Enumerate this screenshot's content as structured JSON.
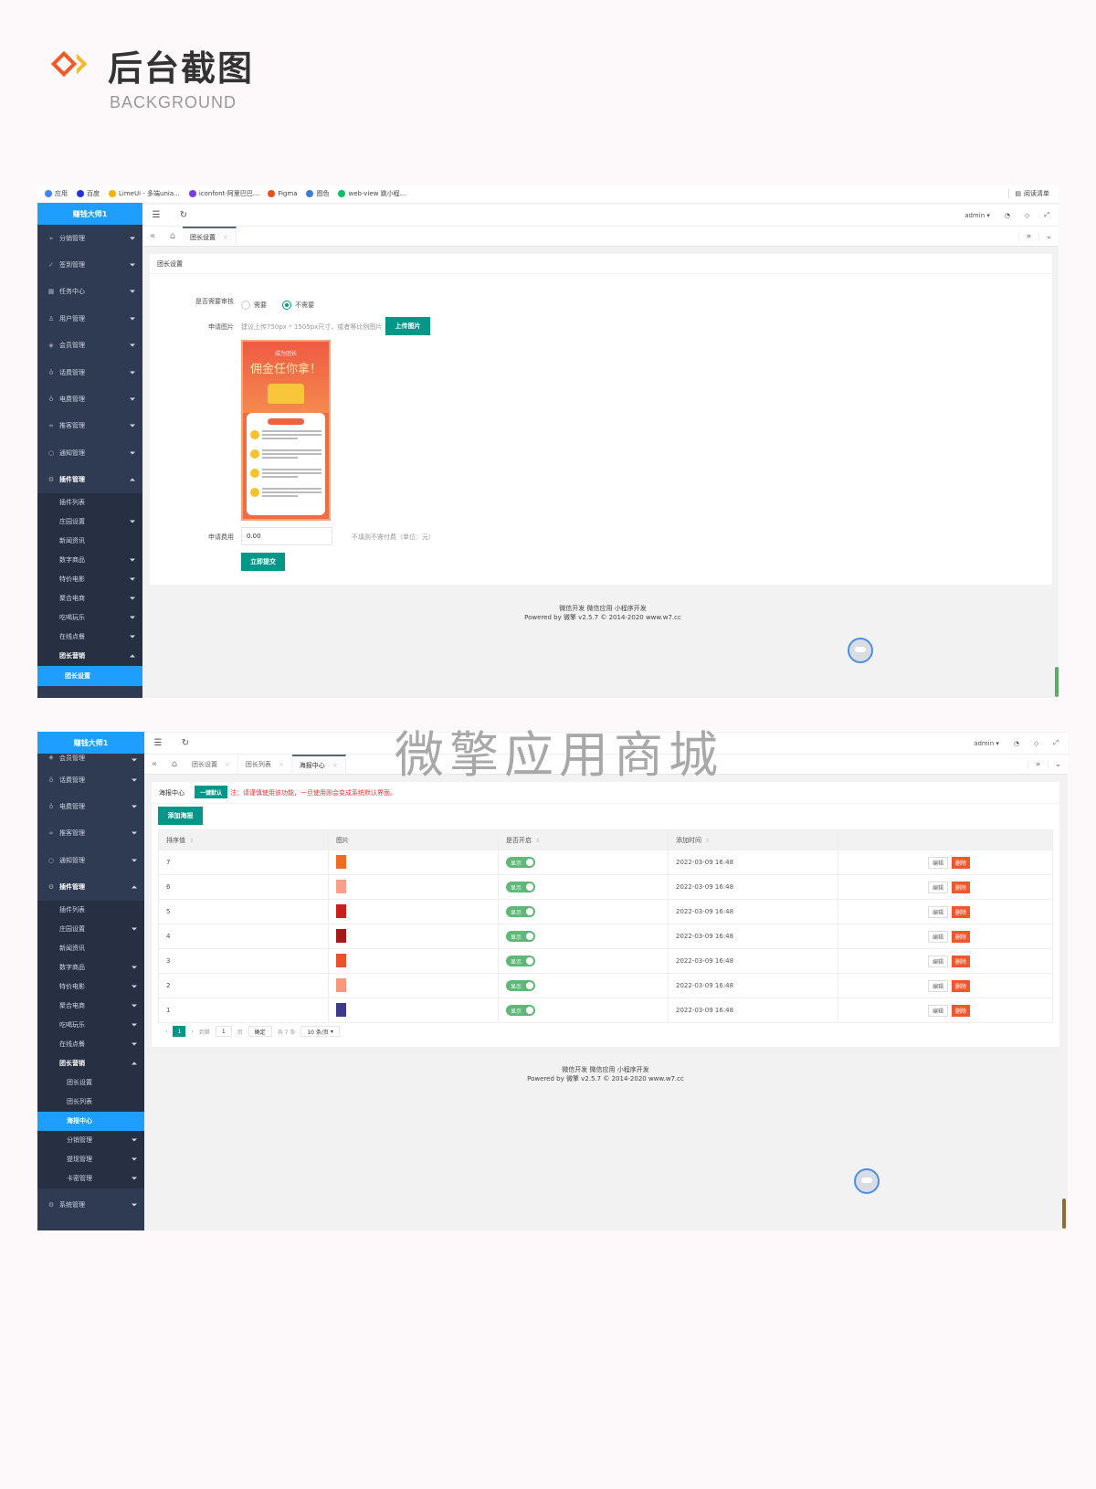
{
  "header": {
    "title": "后台截图",
    "subtitle": "BACKGROUND"
  },
  "watermark": "微擎应用商城",
  "bookmarks": [
    {
      "label": "应用",
      "icon": "apps-grid-icon",
      "color": "#4285f4"
    },
    {
      "label": "百度",
      "icon": "baidu-paw-icon",
      "color": "#2932e1"
    },
    {
      "label": "LimeUi - 多端unia...",
      "icon": "lime-icon",
      "color": "#f5b400"
    },
    {
      "label": "iconfont-阿里巴巴...",
      "icon": "iconfont-icon",
      "color": "#7a3cf0"
    },
    {
      "label": "Figma",
      "icon": "figma-icon",
      "color": "#f24e1e"
    },
    {
      "label": "图色",
      "icon": "image-icon",
      "color": "#3b7ddd"
    },
    {
      "label": "web-view 跳小程...",
      "icon": "wechat-icon",
      "color": "#07c160"
    }
  ],
  "reading_list": "阅读清单",
  "screen1": {
    "brand": "赚钱大师1",
    "user": "admin",
    "sidebar": [
      {
        "label": "分销管理",
        "icon": "send-icon"
      },
      {
        "label": "签到管理",
        "icon": "check-icon"
      },
      {
        "label": "任务中心",
        "icon": "task-icon"
      },
      {
        "label": "用户管理",
        "icon": "user-icon"
      },
      {
        "label": "会员管理",
        "icon": "diamond-icon"
      },
      {
        "label": "话费管理",
        "icon": "apple-icon"
      },
      {
        "label": "电费管理",
        "icon": "apple-icon"
      },
      {
        "label": "推客管理",
        "icon": "link-icon"
      },
      {
        "label": "通知管理",
        "icon": "circle-icon"
      },
      {
        "label": "插件管理",
        "icon": "plugin-icon"
      }
    ],
    "sub": [
      {
        "label": "插件列表",
        "arrow": false
      },
      {
        "label": "庄园设置",
        "arrow": true
      },
      {
        "label": "新闻资讯",
        "arrow": false
      },
      {
        "label": "数字商品",
        "arrow": true
      },
      {
        "label": "特价电影",
        "arrow": true
      },
      {
        "label": "聚合电商",
        "arrow": true
      },
      {
        "label": "吃喝玩乐",
        "arrow": true
      },
      {
        "label": "在线点餐",
        "arrow": true
      },
      {
        "label": "团长营销",
        "arrow": true
      }
    ],
    "active": "团长设置",
    "tabs": [
      "团长设置"
    ],
    "card_title": "团长设置",
    "form": {
      "review_label": "是否需要审核",
      "review_options": [
        "需要",
        "不需要"
      ],
      "review_selected": "不需要",
      "image_label": "申请图片",
      "image_hint": "建议上传750px * 1505px尺寸，或者等比例图片",
      "upload_button": "上传图片",
      "poster_small": "成为团长",
      "poster_big": "佣金任你拿！",
      "fee_label": "申请费用",
      "fee_value": "0.00",
      "fee_hint": "不填则不需付费（单位：元）",
      "submit": "立即提交"
    }
  },
  "screen2": {
    "brand": "赚钱大师1",
    "user": "admin",
    "sidebar_top": [
      {
        "label": "会员管理",
        "icon": "diamond-icon"
      },
      {
        "label": "话费管理",
        "icon": "apple-icon"
      },
      {
        "label": "电费管理",
        "icon": "apple-icon"
      },
      {
        "label": "推客管理",
        "icon": "link-icon"
      },
      {
        "label": "通知管理",
        "icon": "circle-icon"
      },
      {
        "label": "插件管理",
        "icon": "plugin-icon"
      }
    ],
    "sub": [
      {
        "label": "插件列表",
        "arrow": false
      },
      {
        "label": "庄园设置",
        "arrow": true
      },
      {
        "label": "新闻资讯",
        "arrow": false
      },
      {
        "label": "数字商品",
        "arrow": true
      },
      {
        "label": "特价电影",
        "arrow": true
      },
      {
        "label": "聚合电商",
        "arrow": true
      },
      {
        "label": "吃喝玩乐",
        "arrow": true
      },
      {
        "label": "在线点餐",
        "arrow": true
      },
      {
        "label": "团长营销",
        "arrow": true
      }
    ],
    "sub3": [
      {
        "label": "团长设置",
        "arrow": false
      },
      {
        "label": "团长列表",
        "arrow": false
      },
      {
        "label": "海报中心",
        "arrow": false,
        "active": true
      },
      {
        "label": "分销管理",
        "arrow": true
      },
      {
        "label": "提现管理",
        "arrow": true
      },
      {
        "label": "卡密管理",
        "arrow": true
      }
    ],
    "system": "系统管理",
    "tabs": [
      "团长设置",
      "团长列表",
      "海报中心"
    ],
    "card_title": "海报中心",
    "default_button": "一键默认",
    "note": "注：请谨慎使用该功能，一旦使用则会变成系统默认界面。",
    "add_button": "添加海报",
    "columns": [
      "排序值",
      "图片",
      "是否开启",
      "添加时间",
      ""
    ],
    "rows": [
      {
        "sort": "7",
        "thumb": "#f26b24",
        "status": "显示",
        "time": "2022-03-09 16:48"
      },
      {
        "sort": "6",
        "thumb": "#f7a08a",
        "status": "显示",
        "time": "2022-03-09 16:48"
      },
      {
        "sort": "5",
        "thumb": "#c8201f",
        "status": "显示",
        "time": "2022-03-09 16:48"
      },
      {
        "sort": "4",
        "thumb": "#a41a1a",
        "status": "显示",
        "time": "2022-03-09 16:48"
      },
      {
        "sort": "3",
        "thumb": "#e8532d",
        "status": "显示",
        "time": "2022-03-09 16:48"
      },
      {
        "sort": "2",
        "thumb": "#f49a7b",
        "status": "显示",
        "time": "2022-03-09 16:48"
      },
      {
        "sort": "1",
        "thumb": "#3d3a8c",
        "status": "显示",
        "time": "2022-03-09 16:48"
      }
    ],
    "edit_label": "编辑",
    "delete_label": "删除",
    "pager": {
      "current": "1",
      "goto": "到第",
      "page_value": "1",
      "page_unit": "页",
      "confirm": "确定",
      "total": "共 7 条",
      "per_page": "10 条/页"
    }
  },
  "footer": {
    "line1": "微信开发 微信应用 小程序开发",
    "line2": "Powered by 微擎 v2.5.7 © 2014-2020 www.w7.cc"
  }
}
